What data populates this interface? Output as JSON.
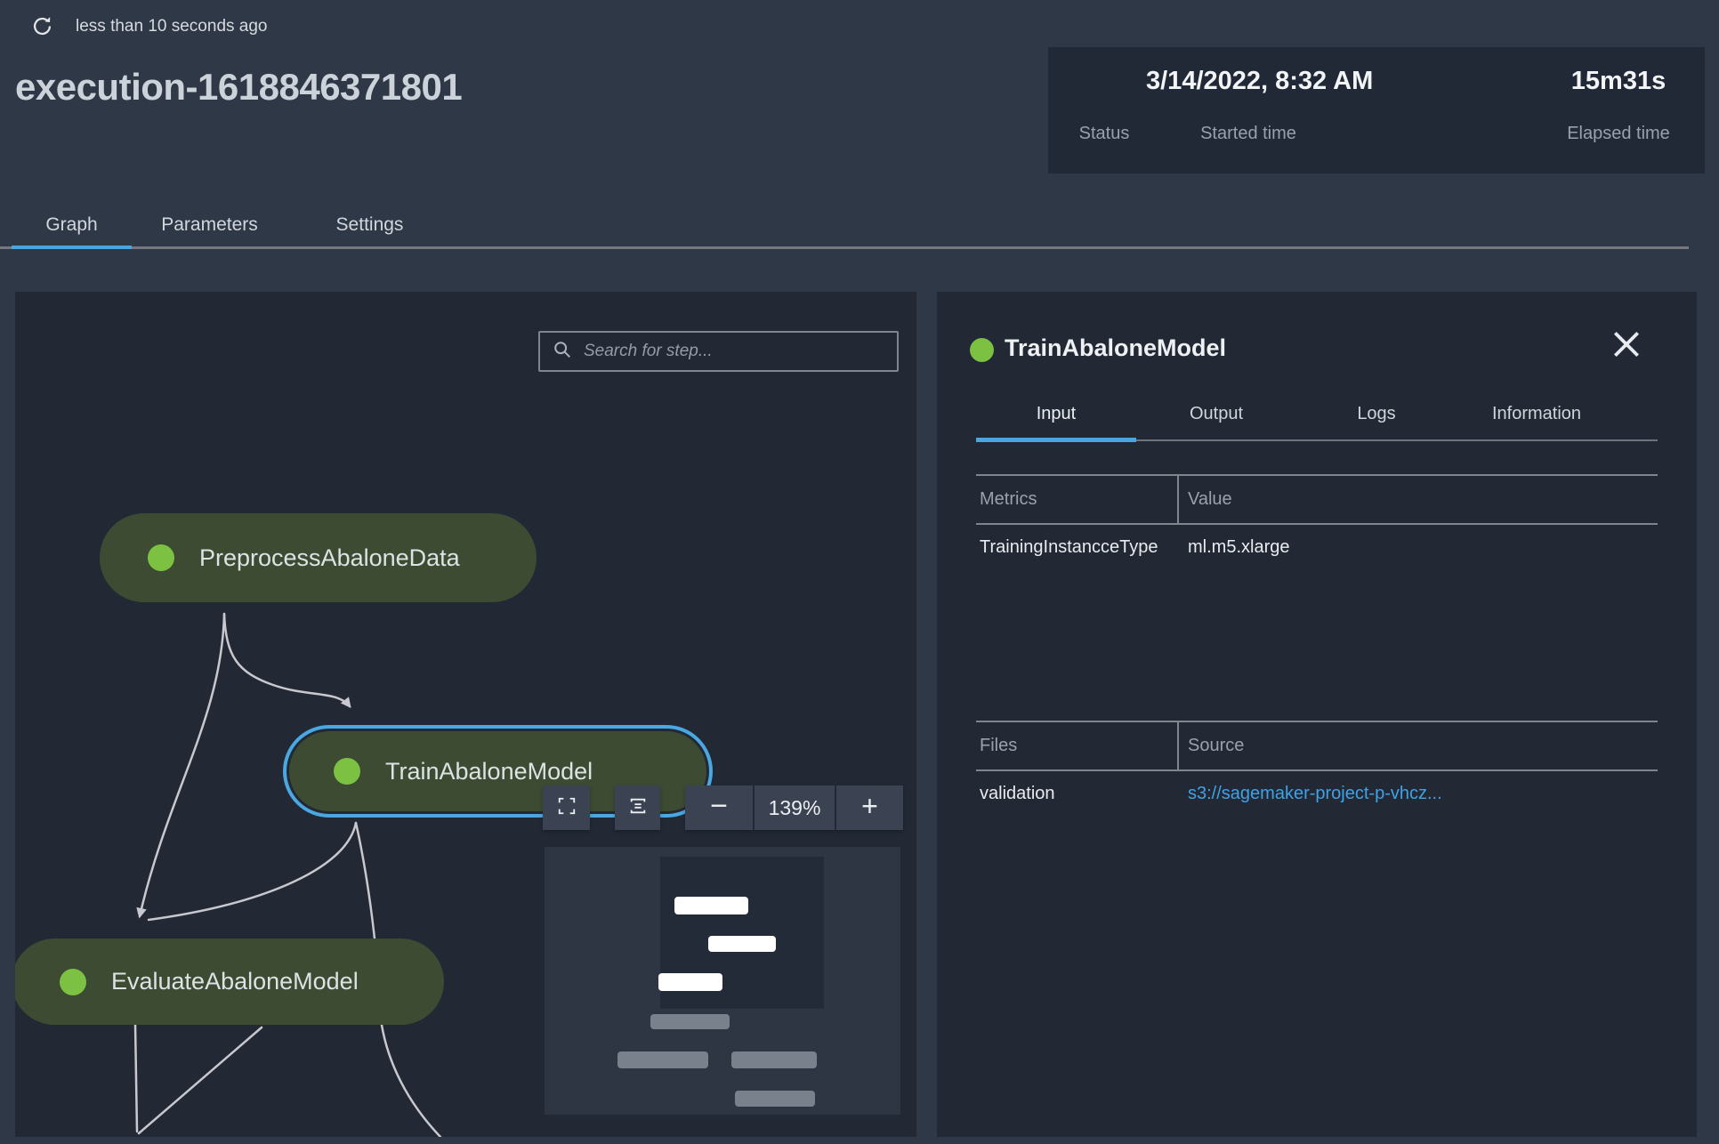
{
  "header": {
    "refresh_status": "less than 10 seconds ago",
    "title": "execution-1618846371801"
  },
  "status_card": {
    "status_label": "Status",
    "started_time_label": "Started time",
    "started_time_value": "3/14/2022, 8:32 AM",
    "elapsed_time_label": "Elapsed time",
    "elapsed_time_value": "15m31s"
  },
  "main_tabs": [
    {
      "label": "Graph",
      "active": true
    },
    {
      "label": "Parameters",
      "active": false
    },
    {
      "label": "Settings",
      "active": false
    }
  ],
  "graph_panel": {
    "search_placeholder": "Search for step...",
    "zoom_level": "139%",
    "zoom_out_label": "−",
    "zoom_in_label": "+",
    "nodes": [
      {
        "label": "PreprocessAbaloneData",
        "status": "succeeded",
        "selected": false
      },
      {
        "label": "TrainAbaloneModel",
        "status": "succeeded",
        "selected": true
      },
      {
        "label": "EvaluateAbaloneModel",
        "status": "succeeded",
        "selected": false
      }
    ]
  },
  "detail_panel": {
    "title": "TrainAbaloneModel",
    "status": "succeeded",
    "tabs": [
      {
        "label": "Input",
        "active": true
      },
      {
        "label": "Output",
        "active": false
      },
      {
        "label": "Logs",
        "active": false
      },
      {
        "label": "Information",
        "active": false
      }
    ],
    "metrics_table": {
      "col1_header": "Metrics",
      "col2_header": "Value",
      "rows": [
        {
          "metric": "TrainingInstancceType",
          "value": "ml.m5.xlarge"
        }
      ]
    },
    "files_table": {
      "col1_header": "Files",
      "col2_header": "Source",
      "rows": [
        {
          "file": "validation",
          "source": "s3://sagemaker-project-p-vhcz..."
        }
      ]
    }
  },
  "colors": {
    "accent_blue": "#4da5dd",
    "selection_blue": "#49a8e1",
    "status_green": "#7dc142",
    "node_green": "#3c4b32",
    "link_blue": "#3fa2e6",
    "panel_bg": "#222935",
    "page_bg": "#2f3846"
  }
}
